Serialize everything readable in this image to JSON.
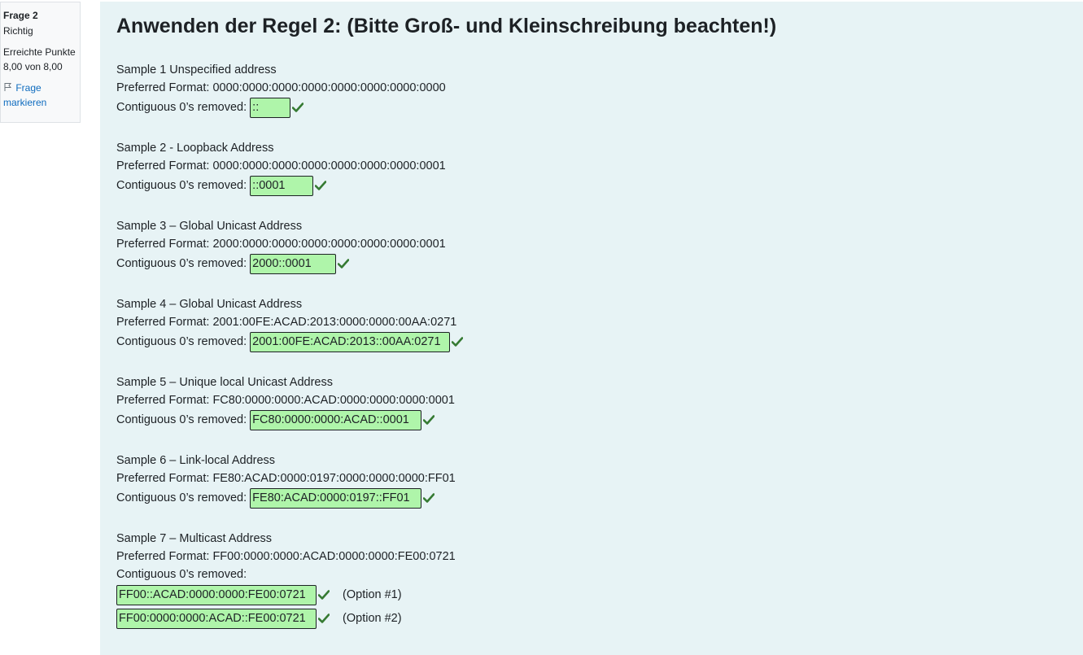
{
  "info": {
    "question_label": "Frage",
    "question_number": "2",
    "state": "Richtig",
    "grade_label": "Erreichte Punkte",
    "grade_value": "8,00 von 8,00",
    "flag_label_1": "Frage",
    "flag_label_2": "markieren"
  },
  "content": {
    "heading": "Anwenden der Regel 2: (Bitte Groß- und Kleinschreibung beachten!)",
    "samples": [
      {
        "title": "Sample 1 Unspecified address",
        "preferred": "Preferred Format: 0000:0000:0000:0000:0000:0000:0000:0000",
        "removed_label": "Contiguous 0’s removed:",
        "answer": "::"
      },
      {
        "title": "Sample 2 - Loopback Address",
        "preferred": "Preferred Format: 0000:0000:0000:0000:0000:0000:0000:0001",
        "removed_label": "Contiguous 0’s removed:",
        "answer": "::0001"
      },
      {
        "title": "Sample 3 – Global Unicast Address",
        "preferred": "Preferred Format: 2000:0000:0000:0000:0000:0000:0000:0001",
        "removed_label": "Contiguous 0’s removed:",
        "answer": "2000::0001"
      },
      {
        "title": "Sample 4 – Global Unicast Address",
        "preferred": "Preferred Format: 2001:00FE:ACAD:2013:0000:0000:00AA:0271",
        "removed_label": "Contiguous 0’s removed:",
        "answer": "2001:00FE:ACAD:2013::00AA:0271"
      },
      {
        "title": "Sample 5 – Unique local Unicast Address",
        "preferred": "Preferred Format: FC80:0000:0000:ACAD:0000:0000:0000:0001",
        "removed_label": "Contiguous 0’s removed:",
        "answer": "FC80:0000:0000:ACAD::0001"
      },
      {
        "title": "Sample 6 – Link-local Address",
        "preferred": "Preferred Format: FE80:ACAD:0000:0197:0000:0000:0000:FF01",
        "removed_label": "Contiguous 0’s removed:",
        "answer": "FE80:ACAD:0000:0197::FF01"
      },
      {
        "title": "Sample 7 – Multicast Address",
        "preferred": "Preferred Format: FF00:0000:0000:ACAD:0000:0000:FE00:0721",
        "removed_label": "Contiguous 0’s removed:",
        "answer_option1": "FF00::ACAD:0000:0000:FE00:0721",
        "option1_label": "(Option #1)",
        "answer_option2": "FF00:0000:0000:ACAD::FE00:0721",
        "option2_label": "(Option #2)"
      }
    ]
  },
  "colors": {
    "correct_bg": "#aff5aa",
    "check": "#357a32",
    "content_bg": "#e7f3f5",
    "link": "#0f6cbf"
  },
  "icons": {
    "check": "check-icon",
    "flag": "flag-icon"
  }
}
